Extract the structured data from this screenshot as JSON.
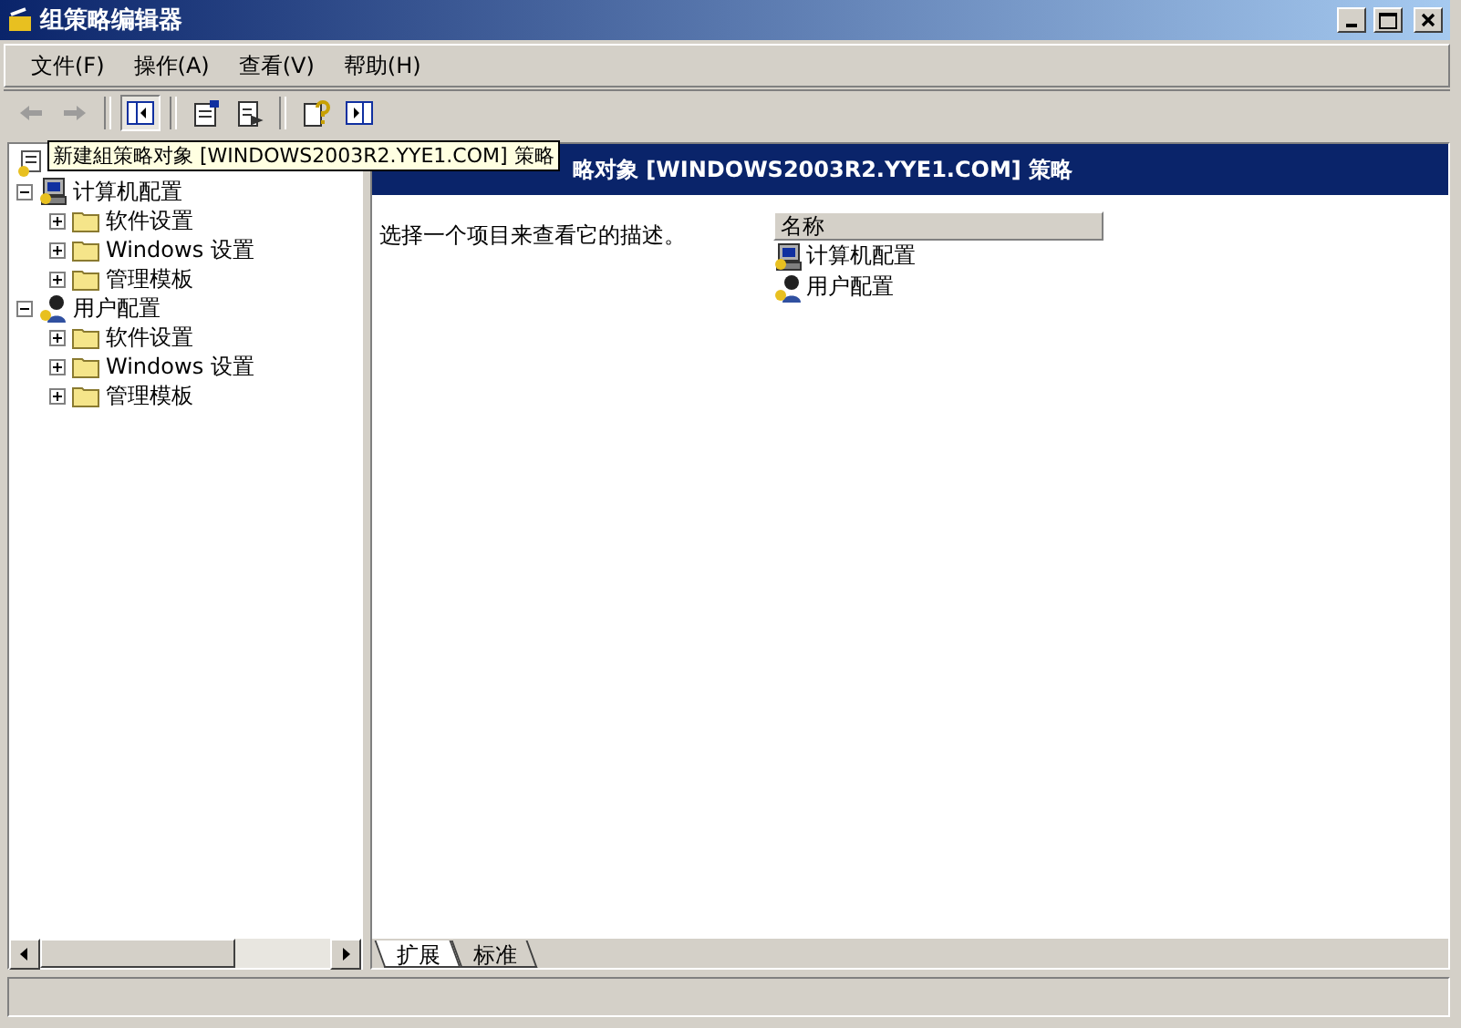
{
  "window": {
    "title": "组策略编辑器"
  },
  "menu": [
    "文件(F)",
    "操作(A)",
    "查看(V)",
    "帮助(H)"
  ],
  "toolbar": [
    {
      "kind": "back",
      "disabled": true
    },
    {
      "kind": "forward",
      "disabled": true
    },
    {
      "kind": "sep"
    },
    {
      "kind": "tree",
      "selected": true
    },
    {
      "kind": "sep"
    },
    {
      "kind": "props",
      "selected": false
    },
    {
      "kind": "export",
      "selected": false
    },
    {
      "kind": "sep"
    },
    {
      "kind": "help",
      "selected": false
    },
    {
      "kind": "pane",
      "selected": false
    }
  ],
  "tooltip": "新建組策略对象 [WINDOWS2003R2.YYE1.COM] 策略",
  "tree": {
    "kind": "policy",
    "children": [
      {
        "label": "计算机配置",
        "kind": "computer",
        "expanded": true,
        "children": [
          {
            "label": "软件设置",
            "kind": "folder",
            "expanded": false
          },
          {
            "label": "Windows 设置",
            "kind": "folder",
            "expanded": false
          },
          {
            "label": "管理模板",
            "kind": "folder",
            "expanded": false
          }
        ]
      },
      {
        "label": "用户配置",
        "kind": "user",
        "expanded": true,
        "children": [
          {
            "label": "软件设置",
            "kind": "folder",
            "expanded": false
          },
          {
            "label": "Windows 设置",
            "kind": "folder",
            "expanded": false
          },
          {
            "label": "管理模板",
            "kind": "folder",
            "expanded": false
          }
        ]
      }
    ]
  },
  "header": {
    "title": "略对象 [WINDOWS2003R2.YYE1.COM] 策略"
  },
  "description": "选择一个项目来查看它的描述。",
  "list": {
    "columns": [
      "名称"
    ],
    "rows": [
      {
        "label": "计算机配置",
        "kind": "computer"
      },
      {
        "label": "用户配置",
        "kind": "user"
      }
    ]
  },
  "tabs": [
    {
      "label": "扩展",
      "selected": true
    },
    {
      "label": "标准",
      "selected": false
    }
  ]
}
